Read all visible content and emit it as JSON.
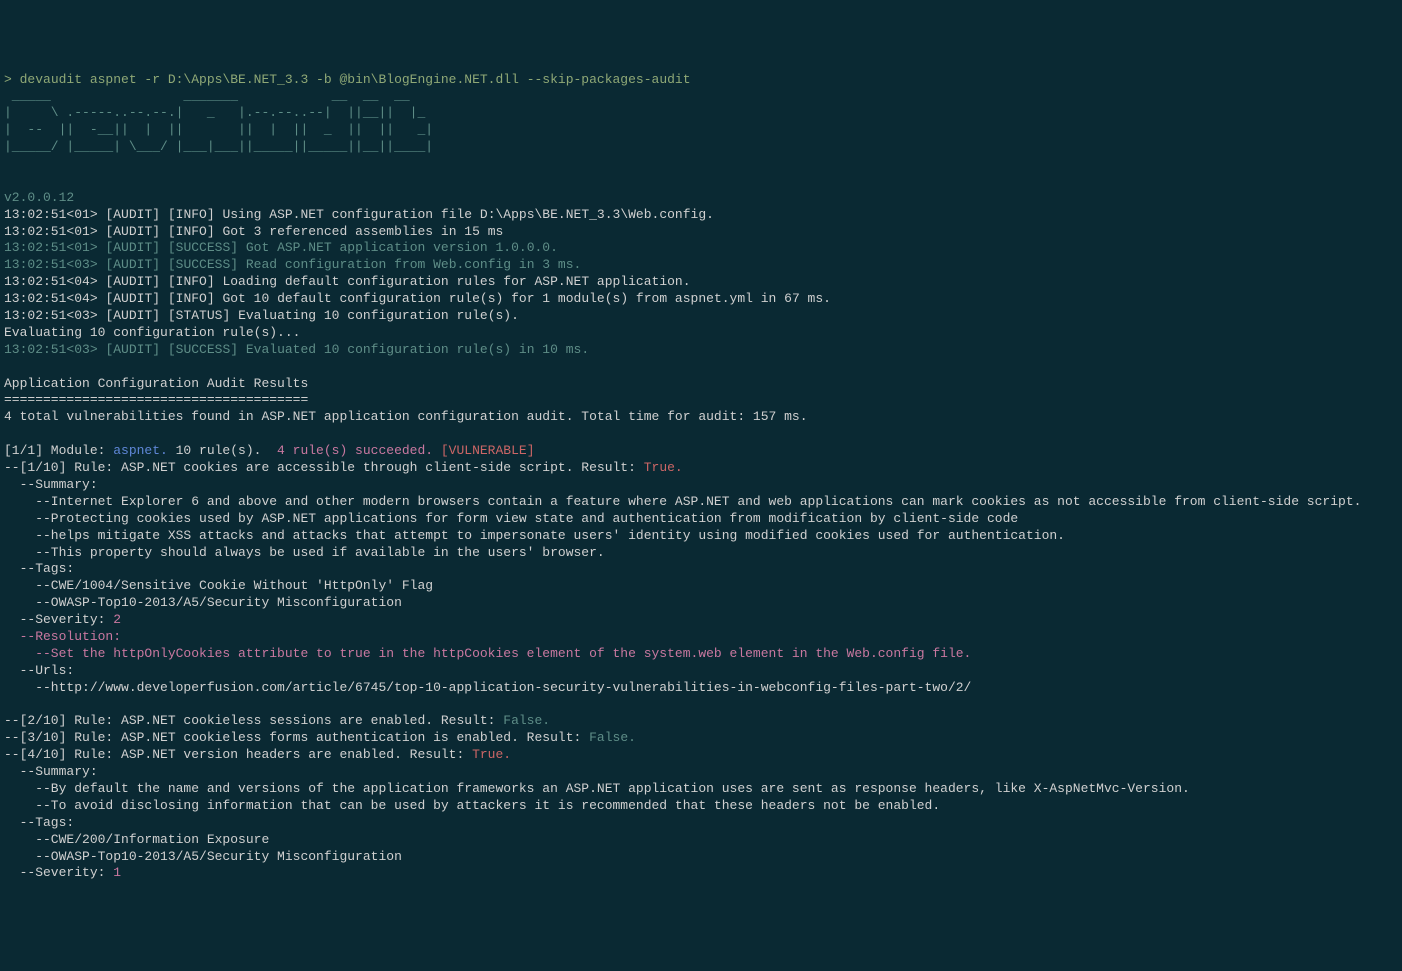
{
  "prompt_char": "> ",
  "command": "devaudit aspnet -r D:\\Apps\\BE.NET_3.3 -b @bin\\BlogEngine.NET.dll --skip-packages-audit",
  "banner": [
    " _____                 _______            __  __  __   ",
    "|     \\ .-----..--.--.|   _   |.--.--..--|  ||__||  |_ ",
    "|  --  ||  -__||  |  ||       ||  |  ||  _  ||  ||   _|",
    "|_____/ |_____| \\___/ |___|___||_____||_____||__||____|",
    "                                                       "
  ],
  "version": "v2.0.0.12",
  "log_lines": [
    {
      "ts": "13:02:51<01>",
      "tag": "[AUDIT] [INFO]",
      "text": " Using ASP.NET configuration file D:\\Apps\\BE.NET_3.3\\Web.config.",
      "class": "white"
    },
    {
      "ts": "13:02:51<01>",
      "tag": "[AUDIT] [INFO]",
      "text": " Got 3 referenced assemblies in 15 ms",
      "class": "white"
    },
    {
      "ts": "13:02:51<01>",
      "tag": "[AUDIT] [SUCCESS]",
      "text": " Got ASP.NET application version 1.0.0.0.",
      "class": "cyan"
    },
    {
      "ts": "13:02:51<03>",
      "tag": "[AUDIT] [SUCCESS]",
      "text": " Read configuration from Web.config in 3 ms.",
      "class": "cyan"
    },
    {
      "ts": "13:02:51<04>",
      "tag": "[AUDIT] [INFO]",
      "text": " Loading default configuration rules for ASP.NET application.",
      "class": "white"
    },
    {
      "ts": "13:02:51<04>",
      "tag": "[AUDIT] [INFO]",
      "text": " Got 10 default configuration rule(s) for 1 module(s) from aspnet.yml in 67 ms.",
      "class": "white"
    },
    {
      "ts": "13:02:51<03>",
      "tag": "[AUDIT] [STATUS]",
      "text": " Evaluating 10 configuration rule(s).",
      "class": "white"
    }
  ],
  "evaluating": "Evaluating 10 configuration rule(s)...",
  "success_evaluated": {
    "ts": "13:02:51<03>",
    "tag": "[AUDIT] [SUCCESS]",
    "text": " Evaluated 10 configuration rule(s) in 10 ms."
  },
  "results_header": "Application Configuration Audit Results",
  "results_sep": "=======================================",
  "results_summary": "4 total vulnerabilities found in ASP.NET application configuration audit. Total time for audit: 157 ms.",
  "module_line": {
    "prefix": "[1/1] Module: ",
    "module": "aspnet.",
    "rules": " 10 rule(s).  ",
    "succeeded": "4 rule(s) succeeded. ",
    "vulnerable": "[VULNERABLE]"
  },
  "rule1": {
    "header_prefix": "--[1/10] Rule: ASP.NET cookies are accessible through client-side script. Result: ",
    "header_result": "True.",
    "summary_label": "  --Summary:",
    "summary_lines": [
      "    --Internet Explorer 6 and above and other modern browsers contain a feature where ASP.NET and web applications can mark cookies as not accessible from client-side script.",
      "    --Protecting cookies used by ASP.NET applications for form view state and authentication from modification by client-side code",
      "    --helps mitigate XSS attacks and attacks that attempt to impersonate users' identity using modified cookies used for authentication.",
      "    --This property should always be used if available in the users' browser."
    ],
    "tags_label": "  --Tags:",
    "tags_lines": [
      "    --CWE/1004/Sensitive Cookie Without 'HttpOnly' Flag",
      "    --OWASP-Top10-2013/A5/Security Misconfiguration"
    ],
    "severity_prefix": "  --Severity: ",
    "severity_value": "2",
    "resolution_label": "  --Resolution:",
    "resolution_text": "    --Set the httpOnlyCookies attribute to true in the httpCookies element of the system.web element in the Web.config file.",
    "urls_label": "  --Urls:",
    "urls_lines": [
      "    --http://www.developerfusion.com/article/6745/top-10-application-security-vulnerabilities-in-webconfig-files-part-two/2/"
    ]
  },
  "rule2": {
    "header_prefix": "--[2/10] Rule: ASP.NET cookieless sessions are enabled. Result: ",
    "header_result": "False."
  },
  "rule3": {
    "header_prefix": "--[3/10] Rule: ASP.NET cookieless forms authentication is enabled. Result: ",
    "header_result": "False."
  },
  "rule4": {
    "header_prefix": "--[4/10] Rule: ASP.NET version headers are enabled. Result: ",
    "header_result": "True.",
    "summary_label": "  --Summary:",
    "summary_lines": [
      "    --By default the name and versions of the application frameworks an ASP.NET application uses are sent as response headers, like X-AspNetMvc-Version.",
      "    --To avoid disclosing information that can be used by attackers it is recommended that these headers not be enabled."
    ],
    "tags_label": "  --Tags:",
    "tags_lines": [
      "    --CWE/200/Information Exposure",
      "    --OWASP-Top10-2013/A5/Security Misconfiguration"
    ],
    "severity_prefix": "  --Severity: ",
    "severity_value": "1"
  }
}
